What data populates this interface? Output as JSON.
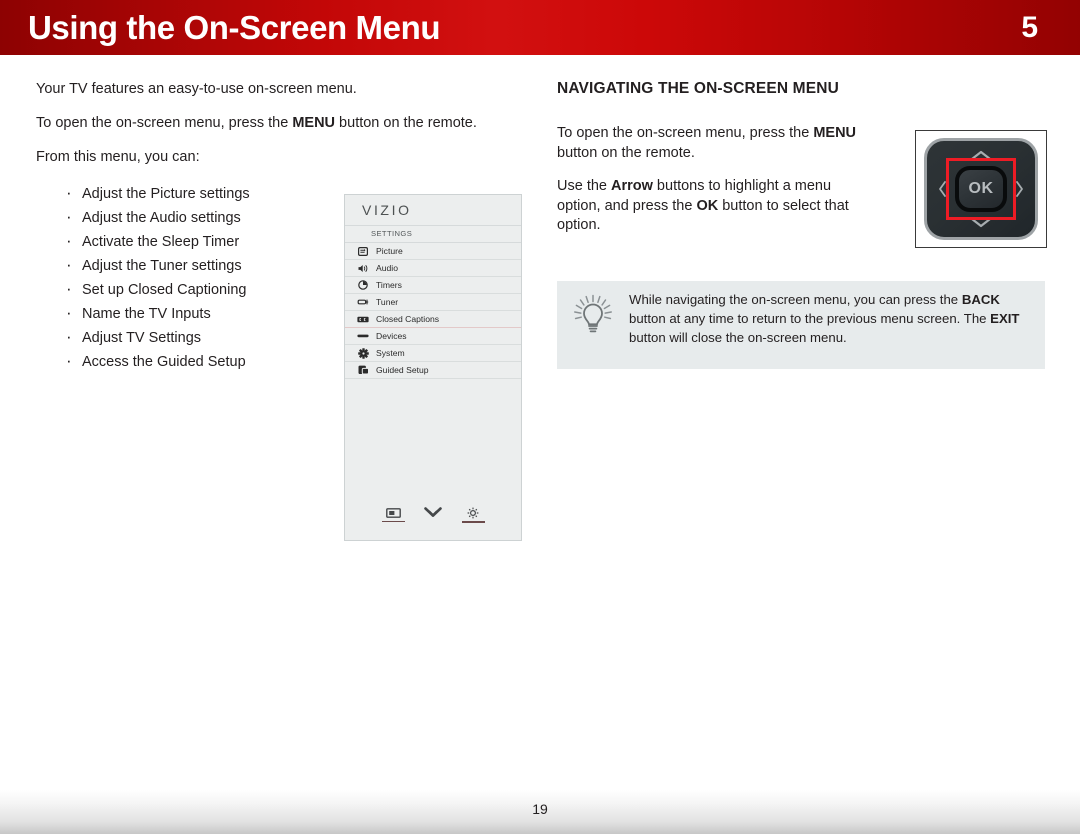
{
  "header": {
    "chapter_title": "Using the On-Screen Menu",
    "chapter_number": "5",
    "bg_start": "#8d0202",
    "bg_mid": "#d21010",
    "bg_end": "#930202",
    "text_color": "#ffffff"
  },
  "left_column": {
    "paragraph_1": "Your TV features an easy-to-use on-screen menu.",
    "paragraph_2_pre": "To open the on-screen menu, press the ",
    "paragraph_2_bold": "MENU",
    "paragraph_2_post": " button on the remote.",
    "paragraph_3": "From this menu, you can:",
    "bullets": [
      "Adjust the Picture settings",
      "Adjust the Audio settings",
      "Activate the Sleep Timer",
      "Adjust the Tuner settings",
      "Set up Closed Captioning",
      "Name the TV Inputs",
      "Adjust TV Settings",
      "Access the Guided Setup"
    ]
  },
  "tv_menu": {
    "brand": "VIZIO",
    "section_label": "SETTINGS",
    "items": [
      {
        "label": "Picture",
        "icon": "picture-icon"
      },
      {
        "label": "Audio",
        "icon": "speaker-icon"
      },
      {
        "label": "Timers",
        "icon": "clock-icon"
      },
      {
        "label": "Tuner",
        "icon": "tuner-icon"
      },
      {
        "label": "Closed Captions",
        "icon": "closed-captions-icon"
      },
      {
        "label": "Devices",
        "icon": "devices-icon"
      },
      {
        "label": "System",
        "icon": "gear-icon"
      },
      {
        "label": "Guided Setup",
        "icon": "guided-setup-icon"
      }
    ],
    "footer_icons": [
      "screen-icon",
      "chevron-double-down-icon",
      "gear-small-icon"
    ],
    "panel_bg": "#eceeee",
    "border_color": "#cdd2d3"
  },
  "right_column": {
    "heading": "NAVIGATING THE ON-SCREEN MENU",
    "paragraph_1_pre": "To open the on-screen menu, press the ",
    "paragraph_1_bold": "MENU",
    "paragraph_1_post": " button on the remote.",
    "paragraph_2_pre": "Use the ",
    "paragraph_2_bold_1": "Arrow",
    "paragraph_2_mid": " buttons to highlight a menu option, and press the ",
    "paragraph_2_bold_2": "OK",
    "paragraph_2_post": " button to select that option."
  },
  "dpad": {
    "ok_label": "OK",
    "up_icon": "chevron-up-icon",
    "down_icon": "chevron-down-icon",
    "left_icon": "chevron-left-icon",
    "right_icon": "chevron-right-icon",
    "highlight_color": "#ee1c25",
    "body_color": "#2a3033"
  },
  "tip": {
    "icon": "lightbulb-icon",
    "text_pre": "While navigating the on-screen menu, you can press the ",
    "bold_1": "BACK",
    "text_mid": " button at any time to return to the previous menu screen. The ",
    "bold_2": "EXIT",
    "text_post": " button will close the on-screen menu.",
    "bg_color": "#e7ebec"
  },
  "footer": {
    "page_number": "19"
  }
}
